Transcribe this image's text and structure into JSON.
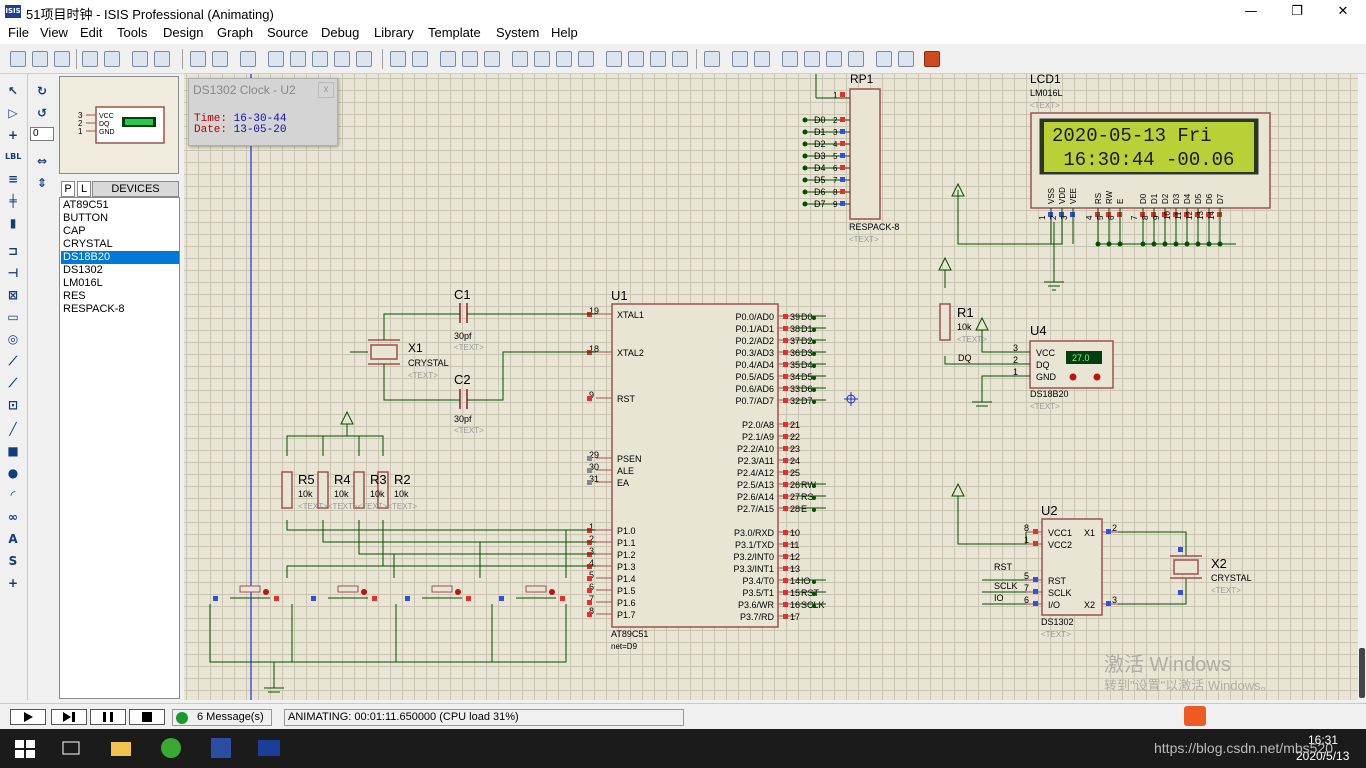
{
  "window": {
    "title": "51项目时钟 - ISIS Professional (Animating)",
    "app_icon": "ISIS",
    "minimize": "—",
    "maximize": "❐",
    "close": "✕"
  },
  "menu": [
    "File",
    "View",
    "Edit",
    "Tools",
    "Design",
    "Graph",
    "Source",
    "Debug",
    "Library",
    "Template",
    "System",
    "Help"
  ],
  "left_panel": {
    "rotation_value": "0",
    "tabs": [
      "P",
      "L"
    ],
    "devices_header": "DEVICES",
    "devices": [
      "AT89C51",
      "BUTTON",
      "CAP",
      "CRYSTAL",
      "DS18B20",
      "DS1302",
      "LM016L",
      "RES",
      "RESPACK-8"
    ],
    "selected_device": "DS18B20",
    "preview_pins": [
      "3",
      "2",
      "1"
    ],
    "preview_pin_labels": [
      "VCC",
      "DQ",
      "GND"
    ]
  },
  "popup": {
    "title": "DS1302 Clock - U2",
    "close": "x",
    "time_label": "Time:",
    "time_value": "16-30-44",
    "date_label": "Date:",
    "date_value": "13-05-20"
  },
  "schematic": {
    "lcd": {
      "ref": "LCD1",
      "part": "LM016L",
      "text": "<TEXT>",
      "line1": "2020-05-13  Fri",
      "line2": " 16:30:44 -00.06",
      "pin_labels": [
        "VSS",
        "VDD",
        "VEE",
        "RS",
        "RW",
        "E",
        "D0",
        "D1",
        "D2",
        "D3",
        "D4",
        "D5",
        "D6",
        "D7"
      ],
      "pin_numbers": [
        "1",
        "2",
        "3",
        "4",
        "5",
        "6",
        "7",
        "8",
        "9",
        "10",
        "11",
        "12",
        "13",
        "14"
      ]
    },
    "rp1": {
      "ref": "RP1",
      "part": "RESPACK-8",
      "text": "<TEXT>",
      "pins": [
        "D0",
        "D1",
        "D2",
        "D3",
        "D4",
        "D5",
        "D6",
        "D7"
      ],
      "nums": [
        "2",
        "3",
        "4",
        "5",
        "6",
        "7",
        "8",
        "9"
      ],
      "common_pin": "1"
    },
    "u1": {
      "ref": "U1",
      "part": "AT89C51",
      "net": "net=D9",
      "left_pins": [
        [
          "19",
          "XTAL1"
        ],
        [
          "18",
          "XTAL2"
        ],
        [
          "9",
          "RST"
        ],
        [
          "29",
          "PSEN"
        ],
        [
          "30",
          "ALE"
        ],
        [
          "31",
          "EA"
        ],
        [
          "1",
          "P1.0"
        ],
        [
          "2",
          "P1.1"
        ],
        [
          "3",
          "P1.2"
        ],
        [
          "4",
          "P1.3"
        ],
        [
          "5",
          "P1.4"
        ],
        [
          "6",
          "P1.5"
        ],
        [
          "7",
          "P1.6"
        ],
        [
          "8",
          "P1.7"
        ]
      ],
      "p0": [
        [
          "P0.0/AD0",
          "39",
          "D0"
        ],
        [
          "P0.1/AD1",
          "38",
          "D1"
        ],
        [
          "P0.2/AD2",
          "37",
          "D2"
        ],
        [
          "P0.3/AD3",
          "36",
          "D3"
        ],
        [
          "P0.4/AD4",
          "35",
          "D4"
        ],
        [
          "P0.5/AD5",
          "34",
          "D5"
        ],
        [
          "P0.6/AD6",
          "33",
          "D6"
        ],
        [
          "P0.7/AD7",
          "32",
          "D7"
        ]
      ],
      "p2": [
        [
          "P2.0/A8",
          "21",
          ""
        ],
        [
          "P2.1/A9",
          "22",
          ""
        ],
        [
          "P2.2/A10",
          "23",
          ""
        ],
        [
          "P2.3/A11",
          "24",
          ""
        ],
        [
          "P2.4/A12",
          "25",
          ""
        ],
        [
          "P2.5/A13",
          "26",
          "RW"
        ],
        [
          "P2.6/A14",
          "27",
          "RS"
        ],
        [
          "P2.7/A15",
          "28",
          "E"
        ]
      ],
      "p3": [
        [
          "P3.0/RXD",
          "10",
          ""
        ],
        [
          "P3.1/TXD",
          "11",
          ""
        ],
        [
          "P3.2/INT0",
          "12",
          ""
        ],
        [
          "P3.3/INT1",
          "13",
          ""
        ],
        [
          "P3.4/T0",
          "14",
          "IO"
        ],
        [
          "P3.5/T1",
          "15",
          "RST"
        ],
        [
          "P3.6/WR",
          "16",
          "SCLK"
        ],
        [
          "P3.7/RD",
          "17",
          ""
        ]
      ]
    },
    "c1": {
      "ref": "C1",
      "value": "30pf",
      "text": "<TEXT>"
    },
    "c2": {
      "ref": "C2",
      "value": "30pf",
      "text": "<TEXT>"
    },
    "x1": {
      "ref": "X1",
      "part": "CRYSTAL",
      "text": "<TEXT>"
    },
    "resistors": [
      {
        "ref": "R5",
        "value": "10k"
      },
      {
        "ref": "R4",
        "value": "10k"
      },
      {
        "ref": "R3",
        "value": "10k"
      },
      {
        "ref": "R2",
        "value": "10k"
      }
    ],
    "res_text": "<TEXT><TEXT><TEXT><TEXT>",
    "r1": {
      "ref": "R1",
      "value": "10k",
      "text": "<TEXT>"
    },
    "u4": {
      "ref": "U4",
      "part": "DS18B20",
      "text": "<TEXT>",
      "pins": [
        [
          "3",
          "VCC"
        ],
        [
          "2",
          "DQ"
        ],
        [
          "1",
          "GND"
        ]
      ],
      "temp": "27.0",
      "net_label": "DQ"
    },
    "u2": {
      "ref": "U2",
      "part": "DS1302",
      "text": "<TEXT>",
      "left": [
        [
          "8",
          "VCC1"
        ],
        [
          "1",
          "VCC2"
        ],
        [
          "5",
          "RST"
        ],
        [
          "7",
          "SCLK"
        ],
        [
          "6",
          "I/O"
        ]
      ],
      "right": [
        [
          "2",
          "X1"
        ],
        [
          "3",
          "X2"
        ]
      ],
      "nets": [
        "RST",
        "SCLK",
        "IO"
      ]
    },
    "x2": {
      "ref": "X2",
      "part": "CRYSTAL",
      "text": "<TEXT>"
    }
  },
  "status": {
    "message_count": "6 Message(s)",
    "animating": "ANIMATING: 00:01:11.650000 (CPU load 31%)"
  },
  "watermark": {
    "line1": "激活 Windows",
    "line2": "转到\"设置\"以激活 Windows。"
  },
  "taskbar": {
    "time": "16:31",
    "date": "2020/5/13",
    "url": "https://blog.csdn.net/mbs520"
  },
  "colors": {
    "grid_bg": "#e8e5d4",
    "wire": "#005000",
    "component": "#a05050",
    "pin_red": "#e53030",
    "pin_blue": "#3050e0",
    "lcd_bg": "#b9d136",
    "selection": "#0078d7"
  }
}
